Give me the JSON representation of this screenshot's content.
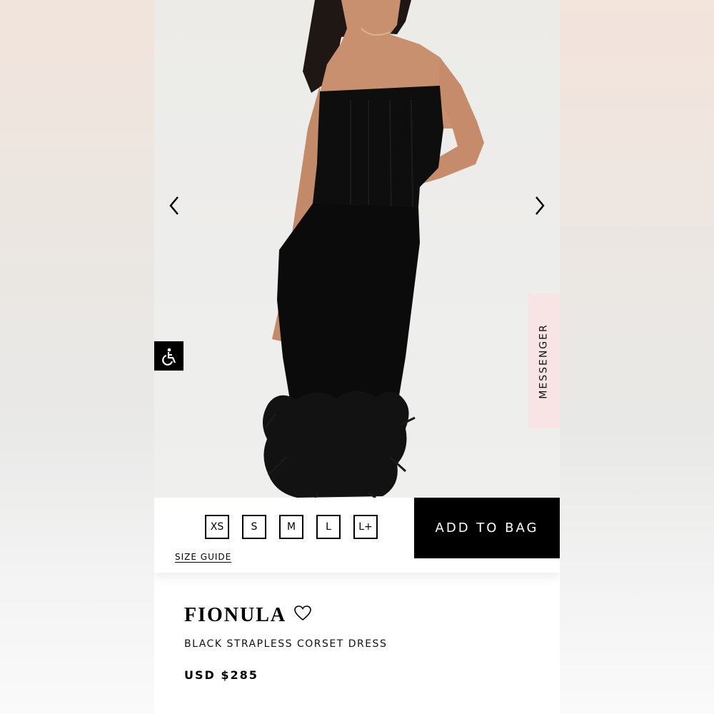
{
  "product": {
    "name": "FIONULA",
    "description": "BLACK STRAPLESS CORSET DRESS",
    "price": "USD $285"
  },
  "carousel": {
    "prev_icon": "chevron-left-icon",
    "next_icon": "chevron-right-icon"
  },
  "sizes": [
    "XS",
    "S",
    "M",
    "L",
    "L+"
  ],
  "size_guide_label": "SIZE GUIDE",
  "add_to_bag_label": "ADD TO BAG",
  "messenger_label": "MESSENGER",
  "accessibility_icon": "wheelchair-icon",
  "wishlist_icon": "heart-outline-icon",
  "colors": {
    "accent": "#000000",
    "messenger_bg": "#f8e4e4",
    "background": "#ffffff"
  }
}
